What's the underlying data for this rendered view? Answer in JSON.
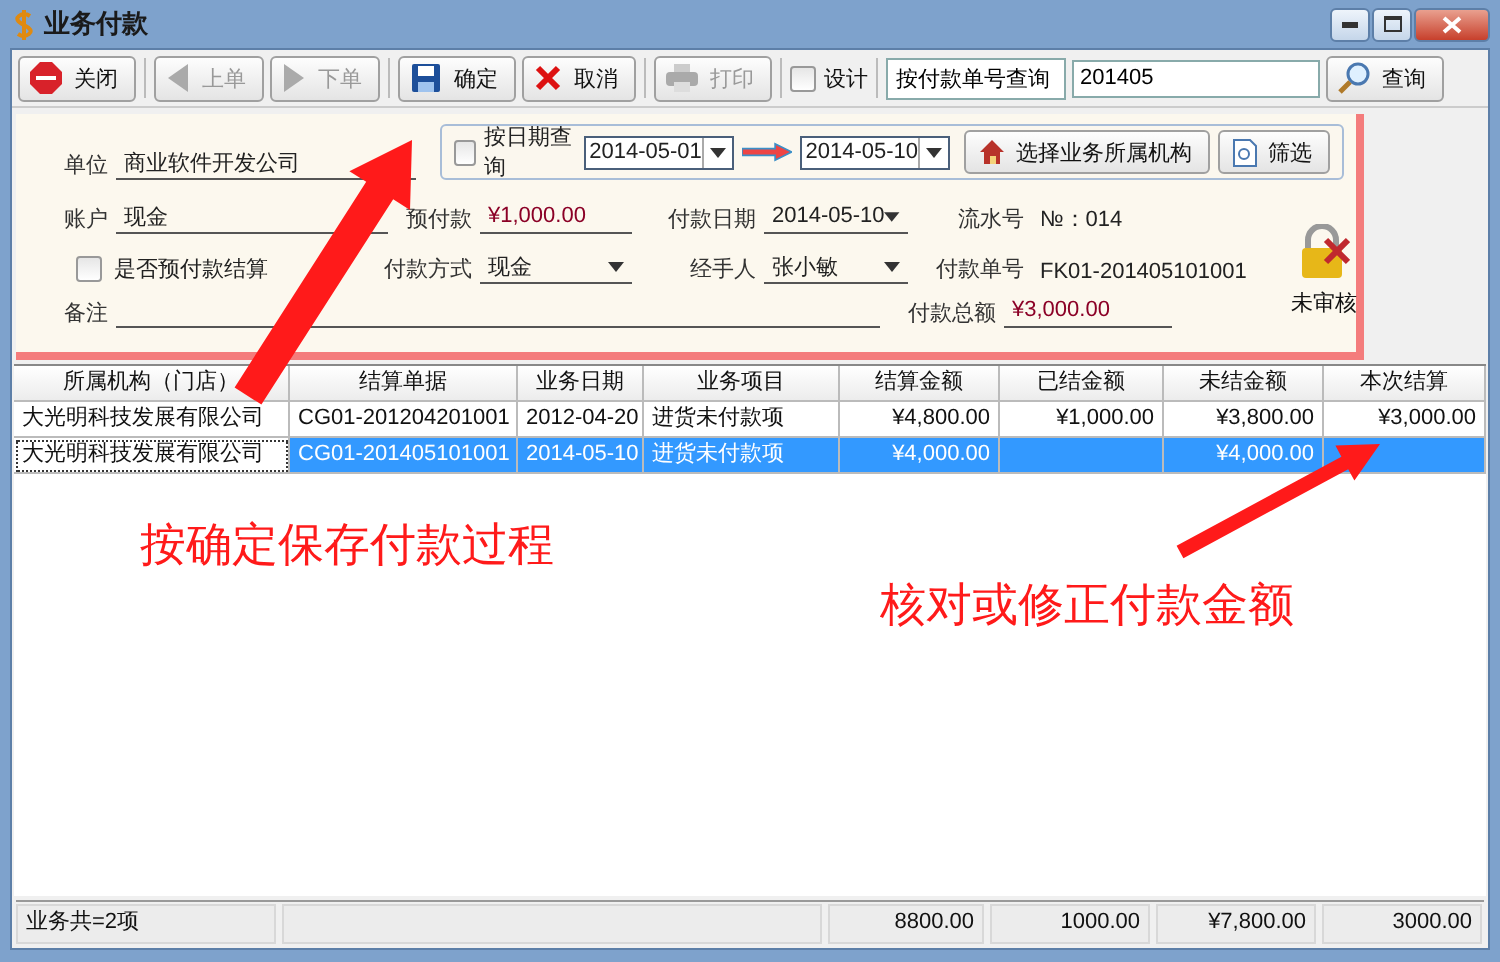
{
  "window": {
    "title": "业务付款"
  },
  "toolbar": {
    "buttons": [
      {
        "label": "关闭",
        "kind": "stop",
        "disabled": false
      },
      {
        "label": "上单",
        "kind": "prev",
        "disabled": true
      },
      {
        "label": "下单",
        "kind": "next",
        "disabled": true
      },
      {
        "label": "确定",
        "kind": "save",
        "disabled": false
      },
      {
        "label": "取消",
        "kind": "cancel",
        "disabled": false
      },
      {
        "label": "打印",
        "kind": "print",
        "disabled": true
      }
    ],
    "design": {
      "label": "设计",
      "checked": false
    },
    "query_mode": "按付款单号查询",
    "query_value": "201405",
    "search_button": "查询"
  },
  "date_query": {
    "label": "按日期查询",
    "checked": false,
    "from": "2014-05-01",
    "to": "2014-05-10",
    "org_button": "选择业务所属机构",
    "filter_button": "筛选"
  },
  "form": {
    "unit": {
      "label": "单位",
      "value": "商业软件开发公司"
    },
    "account": {
      "label": "账户",
      "value": "现金"
    },
    "prepaid": {
      "label": "预付款",
      "value": "¥1,000.00"
    },
    "pay_date": {
      "label": "付款日期",
      "value": "2014-05-10"
    },
    "serial": {
      "label": "流水号",
      "value": "№：014"
    },
    "use_prepaid": {
      "label": "是否预付款结算",
      "checked": false
    },
    "pay_method": {
      "label": "付款方式",
      "value": "现金"
    },
    "handler": {
      "label": "经手人",
      "value": "张小敏"
    },
    "pay_no": {
      "label": "付款单号",
      "value": "FK01-201405101001"
    },
    "remark": {
      "label": "备注"
    },
    "total": {
      "label": "付款总额",
      "value": "¥3,000.00"
    },
    "status": "未审核"
  },
  "table": {
    "columns": [
      "所属机构（门店）",
      "结算单据",
      "业务日期",
      "业务项目",
      "结算金额",
      "已结金额",
      "未结金额",
      "本次结算"
    ],
    "rows": [
      {
        "selected": false,
        "cells": [
          "大光明科技发展有限公司",
          "CG01-201204201001",
          "2012-04-20",
          "进货未付款项",
          "¥4,800.00",
          "¥1,000.00",
          "¥3,800.00",
          "¥3,000.00"
        ]
      },
      {
        "selected": true,
        "cells": [
          "大光明科技发展有限公司",
          "CG01-201405101001",
          "2014-05-10",
          "进货未付款项",
          "¥4,000.00",
          "",
          "¥4,000.00",
          ""
        ]
      }
    ]
  },
  "footer": {
    "count": "业务共=2项",
    "totals": [
      "8800.00",
      "1000.00",
      "¥7,800.00",
      "3000.00"
    ]
  },
  "annotations": [
    "按确定保存付款过程",
    "核对或修正付款金额"
  ]
}
